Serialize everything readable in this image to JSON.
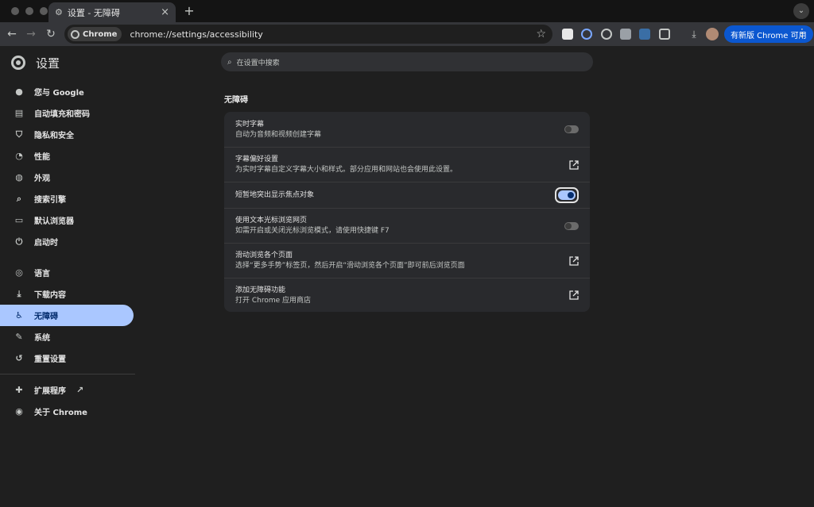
{
  "browser": {
    "tab_title": "设置 - 无障碍",
    "omnibox_chip": "Chrome",
    "url": "chrome://settings/accessibility",
    "update_button": "有新版 Chrome 可用"
  },
  "header": {
    "title": "设置",
    "search_placeholder": "在设置中搜索"
  },
  "sidebar": {
    "items": [
      {
        "label": "您与 Google",
        "icon": "person-icon"
      },
      {
        "label": "自动填充和密码",
        "icon": "clipboard-icon"
      },
      {
        "label": "隐私和安全",
        "icon": "shield-icon"
      },
      {
        "label": "性能",
        "icon": "gauge-icon"
      },
      {
        "label": "外观",
        "icon": "palette-icon"
      },
      {
        "label": "搜索引擎",
        "icon": "search-icon"
      },
      {
        "label": "默认浏览器",
        "icon": "browser-icon"
      },
      {
        "label": "启动时",
        "icon": "power-icon"
      },
      {
        "label": "语言",
        "icon": "globe-icon"
      },
      {
        "label": "下载内容",
        "icon": "download-icon"
      },
      {
        "label": "无障碍",
        "icon": "accessibility-icon"
      },
      {
        "label": "系统",
        "icon": "wrench-icon"
      },
      {
        "label": "重置设置",
        "icon": "reset-icon"
      },
      {
        "label": "扩展程序",
        "icon": "puzzle-icon"
      },
      {
        "label": "关于 Chrome",
        "icon": "chrome-icon"
      }
    ],
    "active": "无障碍"
  },
  "main": {
    "section_title": "无障碍",
    "rows": [
      {
        "label": "实时字幕",
        "sub": "自动为音频和视频创建字幕",
        "control": "toggle",
        "state": "off"
      },
      {
        "label": "字幕偏好设置",
        "sub": "为实时字幕自定义字幕大小和样式。部分应用和网站也会使用此设置。",
        "control": "external-link"
      },
      {
        "label": "短暂地突出显示焦点对象",
        "sub": "",
        "control": "toggle",
        "state": "on"
      },
      {
        "label": "使用文本光标浏览网页",
        "sub": "如需开启或关闭光标浏览模式，请使用快捷键 F7",
        "control": "toggle",
        "state": "off"
      },
      {
        "label": "滑动浏览各个页面",
        "sub": "选择“更多手势”标签页，然后开启“滑动浏览各个页面”即可前后浏览页面",
        "control": "external-link"
      },
      {
        "label": "添加无障碍功能",
        "sub": "打开 Chrome 应用商店",
        "control": "external-link"
      }
    ]
  },
  "colors": {
    "accent": "#aac7ff",
    "update_button": "#0b57d0",
    "card": "#292a2d",
    "background": "#1f1f1f"
  }
}
